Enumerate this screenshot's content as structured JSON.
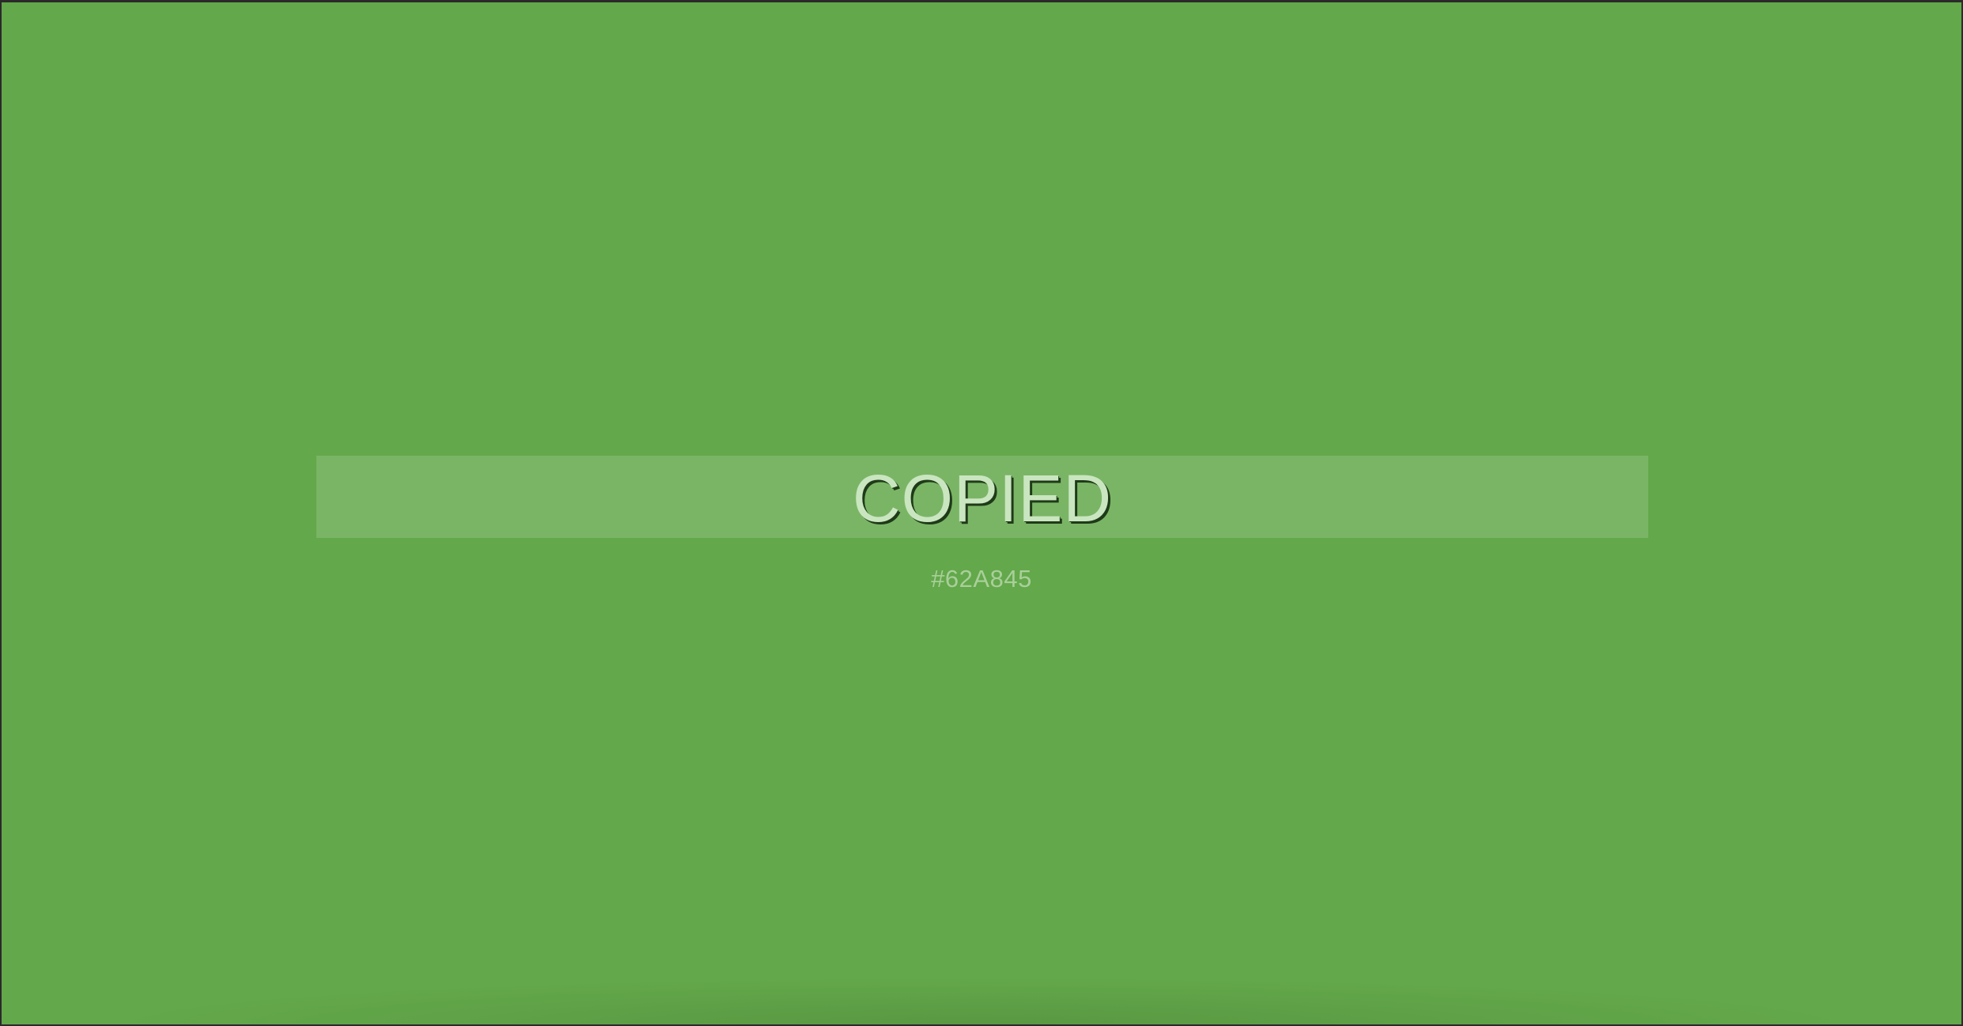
{
  "overlay": {
    "message": "COPIED",
    "color_code": "#62A845"
  },
  "colors": {
    "background": "#63a84a",
    "banner_fill": "rgba(255,255,255,0.15)",
    "message_text": "#c9e6c0",
    "code_text": "#a9cf9b"
  }
}
